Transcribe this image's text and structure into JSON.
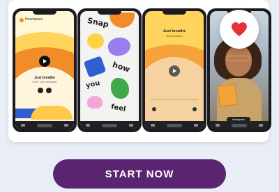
{
  "promo": {
    "phones": [
      {
        "app_label": "Headspace",
        "title": "Just breathe",
        "subtitle": "3 min · Mini Meditation"
      },
      {
        "words": [
          "Snap",
          "how",
          "you",
          "feel"
        ]
      },
      {
        "title": "Just breathe",
        "subtitle": "Mini Meditation"
      },
      {
        "card_label": "Headspace"
      }
    ],
    "heart_icon": "heart-icon"
  },
  "cta": {
    "label": "START NOW"
  },
  "colors": {
    "background": "#e9edf6",
    "button": "#5a2470",
    "heart": "#e3323a",
    "orange": "#f28c28",
    "yellow": "#ffc94a"
  }
}
